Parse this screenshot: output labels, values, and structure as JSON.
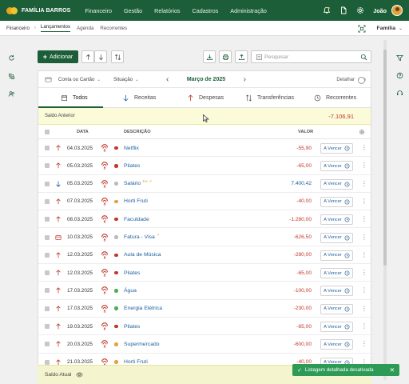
{
  "colors": {
    "brand": "#1b5e38",
    "expense": "#c0392b",
    "income": "#1f5fa0",
    "link": "#1f5fa0",
    "warning_bg": "#fbfbd9",
    "toast": "#2d9b56"
  },
  "brand": {
    "name": "FAMÍLIA BARROS"
  },
  "topnav": [
    "Financeiro",
    "Gestão",
    "Relatórios",
    "Cadastros",
    "Administração"
  ],
  "topright": {
    "icons": [
      "bell-icon",
      "document-icon",
      "gear-icon"
    ],
    "user": "João"
  },
  "subnav": {
    "breadcrumb": "Financeiro",
    "tabs": [
      "Lançamentos",
      "Agenda",
      "Recorrentes"
    ],
    "active_tab": "Lançamentos",
    "family_select": "Família"
  },
  "toolbar": {
    "add_label": "Adicionar",
    "search_placeholder": "Pesquisar"
  },
  "filters": {
    "account": "Conta ou Cartão",
    "status": "Situação",
    "month": "Março de 2025",
    "detail_label": "Detalhar",
    "detail_on": false
  },
  "tabs": [
    {
      "label": "Todos",
      "icon": "calendar-icon",
      "active": true
    },
    {
      "label": "Receitas",
      "icon": "arrow-down-icon",
      "active": false
    },
    {
      "label": "Despesas",
      "icon": "arrow-up-icon",
      "active": false
    },
    {
      "label": "Transferências",
      "icon": "transfer-icon",
      "active": false
    },
    {
      "label": "Recorrentes",
      "icon": "clock-icon",
      "active": false
    }
  ],
  "saldo_anterior": {
    "label": "Saldo Anterior",
    "value": "-7.106,91"
  },
  "table": {
    "headers": {
      "date": "DATA",
      "description": "DESCRIÇÃO",
      "value": "VALOR"
    },
    "status_label": "A Vencer",
    "rows": [
      {
        "type": "expense",
        "date": "04.03.2025",
        "dot": "#c0392b",
        "desc": "Netflix",
        "sup": "",
        "value": "-55,90"
      },
      {
        "type": "expense",
        "date": "05.03.2025",
        "dot": "#c0392b",
        "desc": "Pilates",
        "sup": "",
        "value": "-65,00"
      },
      {
        "type": "income",
        "date": "05.03.2025",
        "dot": "#bbbbbb",
        "desc": "Salário",
        "sup": "1/∞ ↗",
        "value": "7.400,42"
      },
      {
        "type": "expense",
        "date": "07.03.2025",
        "dot": "#e6a23c",
        "desc": "Horti Fruti",
        "sup": "",
        "value": "-40,00"
      },
      {
        "type": "expense",
        "date": "08.03.2025",
        "dot": "#c0392b",
        "desc": "Faculdade",
        "sup": "",
        "value": "-1.280,00"
      },
      {
        "type": "card",
        "date": "10.03.2025",
        "dot": "#bbbbbb",
        "desc": "Fatura - Visa",
        "sup": "↗",
        "value": "-626,50"
      },
      {
        "type": "expense",
        "date": "12.03.2025",
        "dot": "#c0392b",
        "desc": "Aula de Música",
        "sup": "",
        "value": "-280,00"
      },
      {
        "type": "expense",
        "date": "12.03.2025",
        "dot": "#c0392b",
        "desc": "Pilates",
        "sup": "",
        "value": "-65,00"
      },
      {
        "type": "expense",
        "date": "17.03.2025",
        "dot": "#4caf50",
        "desc": "Água",
        "sup": "",
        "value": "-100,00"
      },
      {
        "type": "expense",
        "date": "17.03.2025",
        "dot": "#4caf50",
        "desc": "Energia Elétrica",
        "sup": "",
        "value": "-230,00"
      },
      {
        "type": "expense",
        "date": "19.03.2025",
        "dot": "#c0392b",
        "desc": "Pilates",
        "sup": "",
        "value": "-65,00"
      },
      {
        "type": "expense",
        "date": "20.03.2025",
        "dot": "#e6a23c",
        "desc": "Supermercado",
        "sup": "",
        "value": "-600,00"
      },
      {
        "type": "expense",
        "date": "21.03.2025",
        "dot": "#e6a23c",
        "desc": "Horti Fruti",
        "sup": "",
        "value": "-40,00"
      }
    ]
  },
  "saldo_atual": {
    "label": "Saldo Atual"
  },
  "toast": {
    "text": "Listagem detalhada desativada"
  }
}
